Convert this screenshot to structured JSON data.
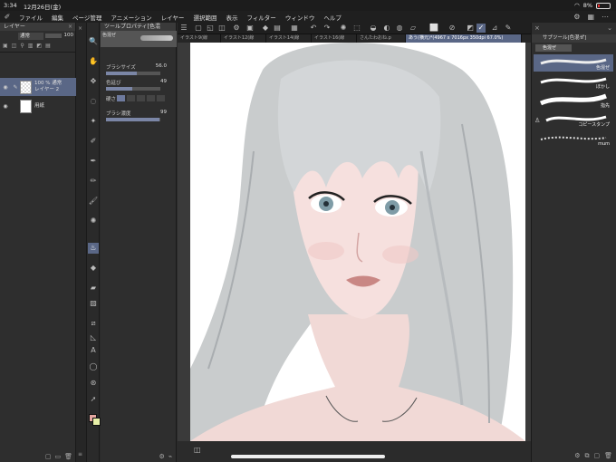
{
  "status": {
    "time": "3:34",
    "date": "12月26日(金)",
    "battery": "8%"
  },
  "menu": [
    "ファイル",
    "編集",
    "ページ管理",
    "アニメーション",
    "レイヤー",
    "選択範囲",
    "表示",
    "フィルター",
    "ウィンドウ",
    "ヘルプ"
  ],
  "layer_panel": {
    "title": "レイヤー",
    "blend_mode": "通常",
    "opacity": "100",
    "layers": [
      {
        "line1": "100 % 通常",
        "line2": "レイヤー 2"
      },
      {
        "line1": "",
        "line2": "用紙"
      }
    ]
  },
  "tool_property": {
    "title": "ツールプロパティ[色混",
    "preset": "色混ぜ",
    "brush_size_label": "ブラシサイズ",
    "brush_size": "56.0",
    "blend_label": "色延び",
    "blend": "49",
    "hardness_label": "硬さ",
    "density_label": "ブラシ濃度",
    "density": "99",
    "hardness_level": 1,
    "brush_size_fraction": 0.56,
    "blend_fraction": 0.49,
    "density_fraction": 0.99
  },
  "tabs": [
    "イラスト9(線",
    "イラスト12(線",
    "イラスト14(線",
    "イラスト16(線",
    "さんたわおね.p",
    "あう(横元)*(4967 x 7016px 350dpi 67.0%)"
  ],
  "subtool": {
    "title": "サブツール[色混ぜ]",
    "group": "色混ぜ",
    "brushes": [
      "色混ぜ",
      "ぼかし",
      "指先",
      "コピースタンプ",
      "mum"
    ]
  },
  "colors": {
    "main": "#e4a6a0",
    "sub": "#e8f0a8",
    "accent": "#5a6786"
  }
}
